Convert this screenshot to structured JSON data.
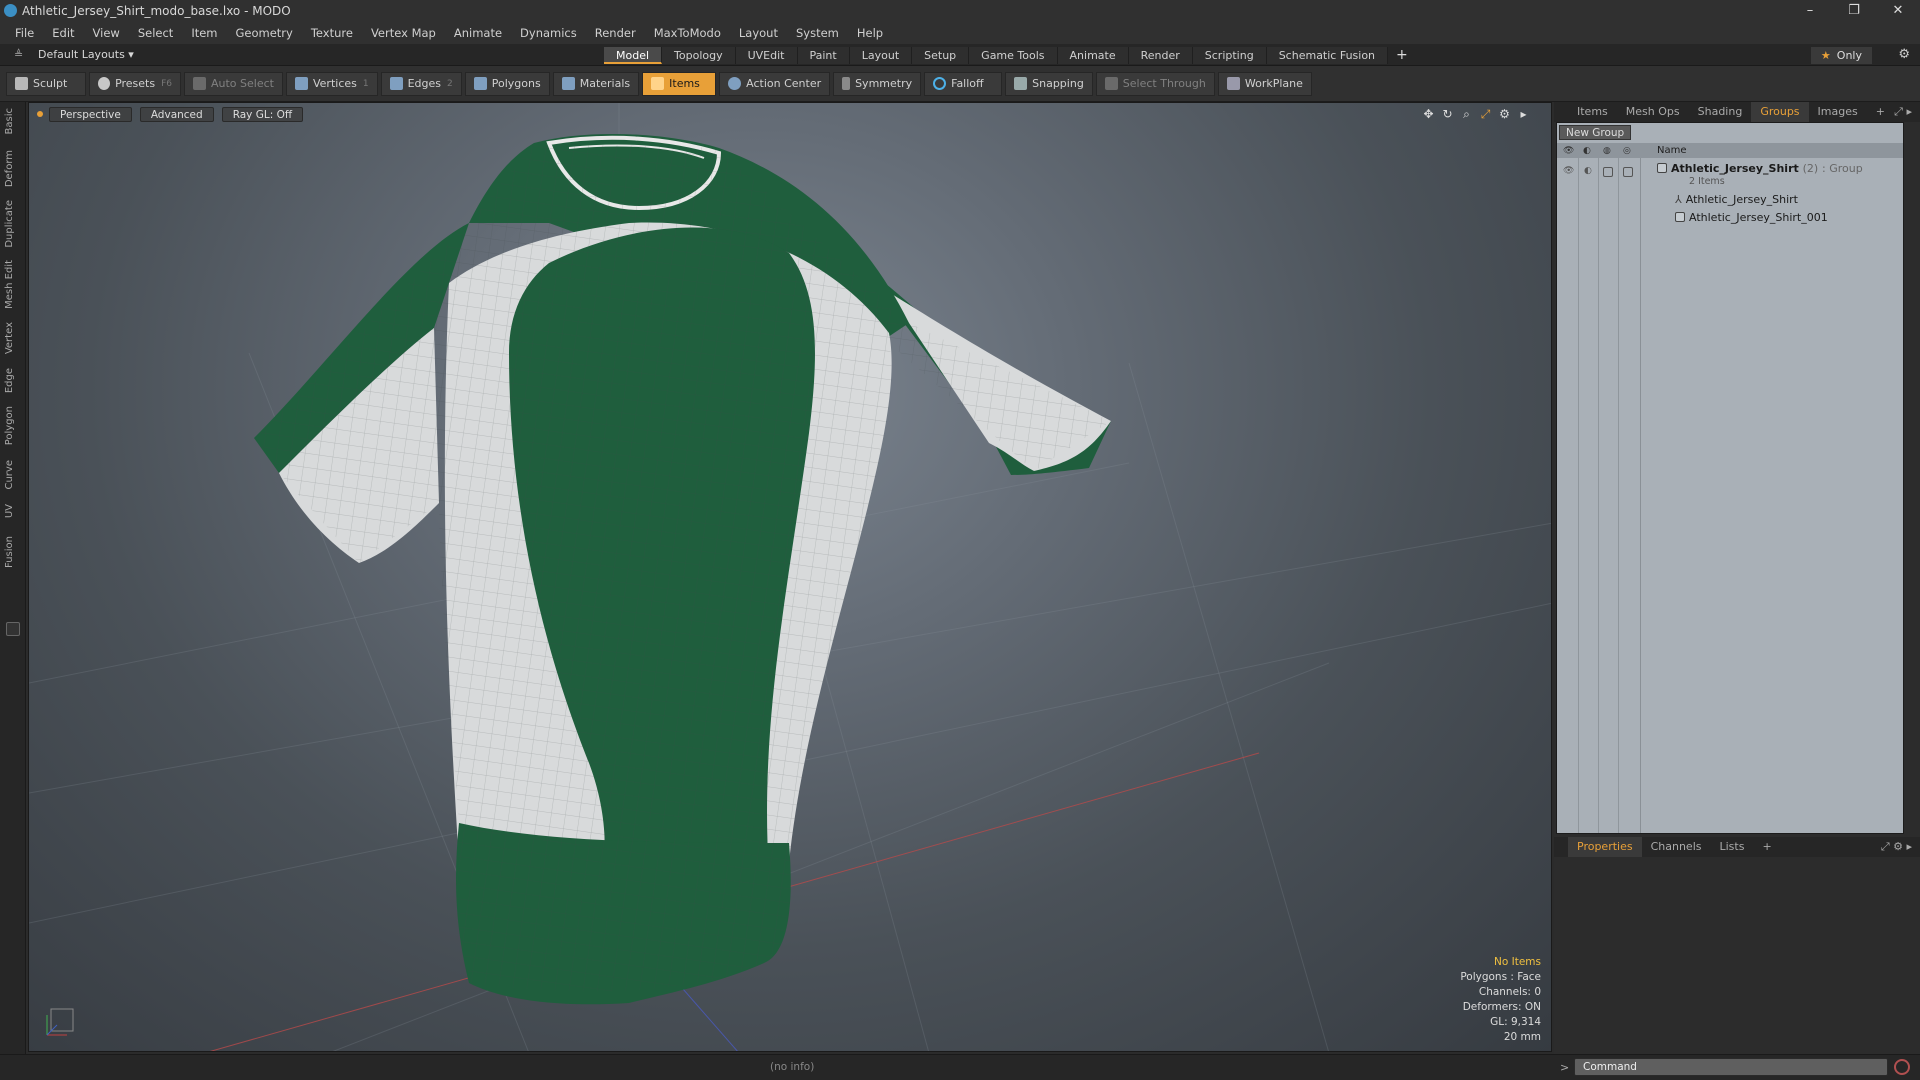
{
  "window": {
    "title": "Athletic_Jersey_Shirt_modo_base.lxo - MODO",
    "controls": [
      "–",
      "❐",
      "✕"
    ]
  },
  "menu": [
    "File",
    "Edit",
    "View",
    "Select",
    "Item",
    "Geometry",
    "Texture",
    "Vertex Map",
    "Animate",
    "Dynamics",
    "Render",
    "MaxToModo",
    "Layout",
    "System",
    "Help"
  ],
  "layout_selector": "Default Layouts ▾",
  "tabs": [
    {
      "label": "Model",
      "active": true
    },
    {
      "label": "Topology"
    },
    {
      "label": "UVEdit"
    },
    {
      "label": "Paint"
    },
    {
      "label": "Layout"
    },
    {
      "label": "Setup"
    },
    {
      "label": "Game Tools"
    },
    {
      "label": "Animate"
    },
    {
      "label": "Render"
    },
    {
      "label": "Scripting"
    },
    {
      "label": "Schematic Fusion"
    }
  ],
  "tabs_add": "+",
  "only_label": "Only",
  "toolbar": {
    "sculpt": "Sculpt",
    "presets": "Presets",
    "presets_key": "F6",
    "auto_select": "Auto Select",
    "vertices": "Vertices",
    "vertices_num": "1",
    "edges": "Edges",
    "edges_num": "2",
    "polygons": "Polygons",
    "materials": "Materials",
    "items": "Items",
    "action_center": "Action Center",
    "symmetry": "Symmetry",
    "falloff": "Falloff",
    "snapping": "Snapping",
    "select_through": "Select Through",
    "workplane": "WorkPlane"
  },
  "left_tabs": [
    "Basic",
    "Deform",
    "Duplicate",
    "Mesh Edit",
    "Vertex",
    "Edge",
    "Polygon",
    "Curve",
    "UV",
    "Fusion"
  ],
  "viewport": {
    "view_mode": "Perspective",
    "shading": "Advanced",
    "raygl": "Ray GL: Off",
    "info": {
      "selection": "No Items",
      "polygons": "Polygons : Face",
      "channels": "Channels: 0",
      "deformers": "Deformers: ON",
      "gl": "GL: 9,314",
      "scale": "20 mm"
    },
    "colors": {
      "jersey_green": "#1f5e3d",
      "jersey_white": "#d8dadb"
    }
  },
  "panel_tabs": [
    "Items",
    "Mesh Ops",
    "Shading",
    "Groups",
    "Images"
  ],
  "panel_tabs_active": "Groups",
  "panel_add": "+",
  "groups": {
    "new_group": "New Group",
    "column_name": "Name",
    "parent": {
      "name": "Athletic_Jersey_Shirt",
      "count": "(2)",
      "type": ": Group",
      "sub": "2 Items"
    },
    "children": [
      "Athletic_Jersey_Shirt",
      "Athletic_Jersey_Shirt_001"
    ]
  },
  "props_tabs": [
    "Properties",
    "Channels",
    "Lists"
  ],
  "props_tabs_active": "Properties",
  "props_add": "+",
  "status": {
    "info": "(no info)",
    "command_placeholder": "Command"
  },
  "accent": "#e8a038"
}
